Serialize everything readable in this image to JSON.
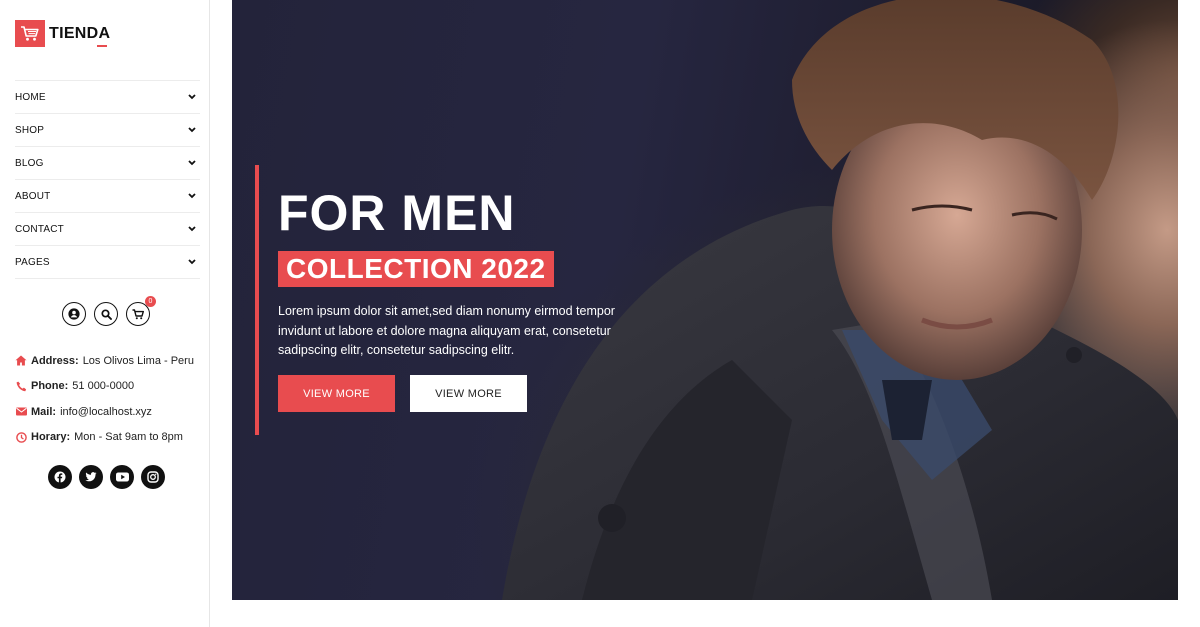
{
  "brand": {
    "name": "TIENDA",
    "logo_icon": "shopping-cart-icon",
    "accent_color": "#e84c4f"
  },
  "menu": [
    {
      "label": "HOME"
    },
    {
      "label": "SHOP"
    },
    {
      "label": "BLOG"
    },
    {
      "label": "ABOUT"
    },
    {
      "label": "CONTACT"
    },
    {
      "label": "PAGES"
    }
  ],
  "tools": {
    "cart_count": "0"
  },
  "info": {
    "address_label": "Address:",
    "address_value": "Los Olivos Lima - Peru",
    "phone_label": "Phone:",
    "phone_value": "51 000-0000",
    "mail_label": "Mail:",
    "mail_value": "info@localhost.xyz",
    "horary_label": "Horary:",
    "horary_value": "Mon - Sat 9am to 8pm"
  },
  "social": [
    "facebook-icon",
    "twitter-icon",
    "youtube-icon",
    "instagram-icon"
  ],
  "hero": {
    "title": "FOR MEN",
    "tag": "COLLECTION 2022",
    "description": "Lorem ipsum dolor sit amet,sed diam nonumy eirmod tempor invidunt ut labore et dolore magna aliquyam erat, consetetur sadipscing elitr, consetetur sadipscing elitr.",
    "primary_button": "VIEW MORE",
    "secondary_button": "VIEW MORE"
  }
}
